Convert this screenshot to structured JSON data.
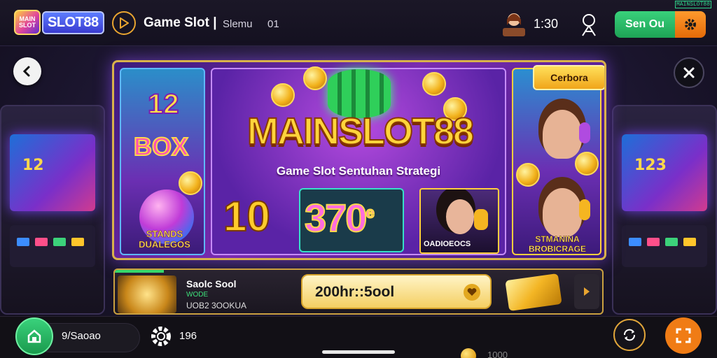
{
  "header": {
    "logo_badge": "MAIN SLOT",
    "logo_text": "SLOT88",
    "title": "Game Slot |",
    "title_sub": "Slemu",
    "title_num": "01",
    "balance": "1:30",
    "signin_label": "Sen Ou",
    "corner_tag": "MAINSLOT88"
  },
  "banner": {
    "left_number": "12",
    "left_word": "BOX",
    "left_caption": "STANDS DUALEGOS",
    "brand": "MAINSLOT88",
    "tagline": "Game Slot Sentuhan Strategi",
    "number_left": "10",
    "number_right": "370",
    "number_right_sup": "e",
    "photo_caption": "OADIOEOCS",
    "tag_button": "Cerbora",
    "right_caption": "STMANINA BROBICRAGE"
  },
  "promo": {
    "progress": 0.1,
    "title": "Saolc Sool",
    "sub": "WODE",
    "code": "UOB2 3OOKUA",
    "timer": "200hr::5ool"
  },
  "bottom": {
    "pill_text": "9/Saoao",
    "count": "196",
    "amount": "1000"
  },
  "colors": {
    "accent_green": "#39d17b",
    "accent_orange": "#f07c15",
    "gold": "#ffd43b"
  },
  "icons": {
    "back": "arrow-left-icon",
    "close": "close-icon",
    "play": "play-icon",
    "profile": "user-icon",
    "settings": "gear-icon",
    "home": "home-icon",
    "sync": "sync-icon",
    "expand": "expand-icon"
  }
}
